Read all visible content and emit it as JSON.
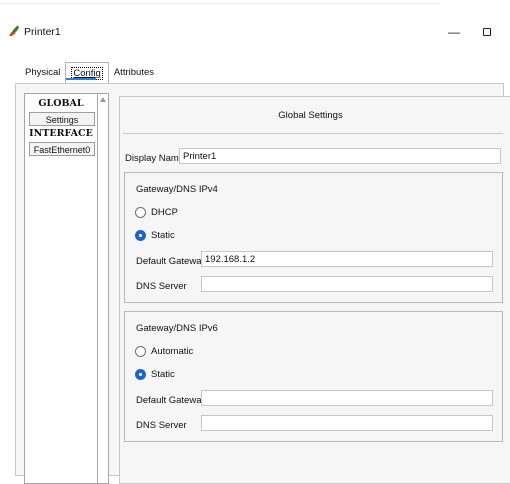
{
  "window": {
    "title": "Printer1",
    "minimize_glyph": "—",
    "app_icon": "printer-feather-icon"
  },
  "tabs": [
    {
      "label": "Physical",
      "active": false
    },
    {
      "label": "Config",
      "active": true
    },
    {
      "label": "Attributes",
      "active": false
    }
  ],
  "sidebar": {
    "global_heading": "GLOBAL",
    "settings_button": "Settings",
    "interface_heading": "INTERFACE",
    "interface_item": "FastEthernet0"
  },
  "settings": {
    "title": "Global Settings",
    "display_name_label": "Display Name",
    "display_name_value": "Printer1"
  },
  "ipv4": {
    "title": "Gateway/DNS IPv4",
    "dhcp_label": "DHCP",
    "static_label": "Static",
    "selected": "Static",
    "gateway_label": "Default Gateway",
    "gateway_value": "192.168.1.2",
    "dns_label": "DNS Server",
    "dns_value": ""
  },
  "ipv6": {
    "title": "Gateway/DNS IPv6",
    "automatic_label": "Automatic",
    "static_label": "Static",
    "selected": "Static",
    "gateway_label": "Default Gateway",
    "gateway_value": "",
    "dns_label": "DNS Server",
    "dns_value": ""
  },
  "colors": {
    "accent": "#1f63c4",
    "tab_underline": "#2f7ed8"
  }
}
